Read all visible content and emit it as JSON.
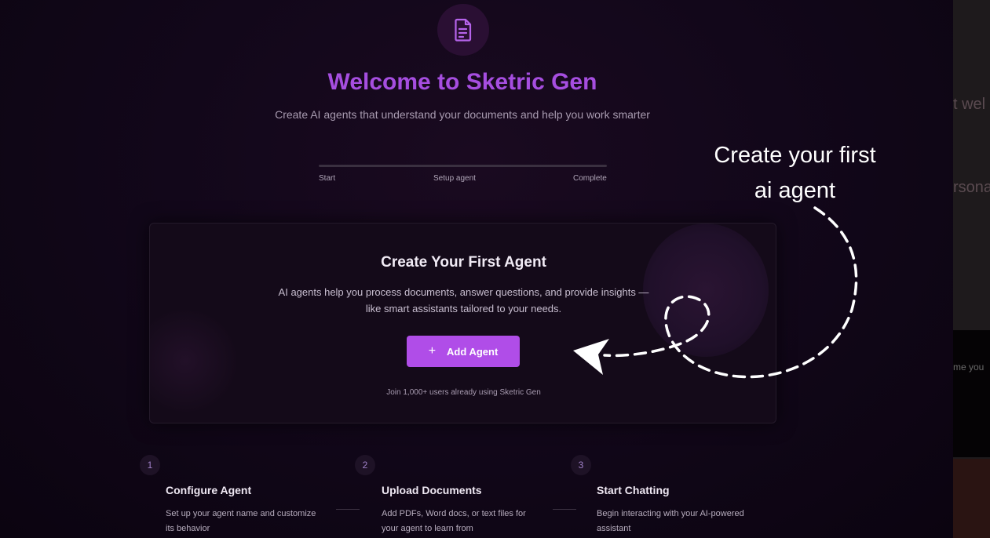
{
  "header": {
    "title": "Welcome to Sketric Gen",
    "subtitle": "Create AI agents that understand your documents and help you work smarter",
    "logo_icon": "document-icon"
  },
  "progress": {
    "steps": [
      "Start",
      "Setup agent",
      "Complete"
    ]
  },
  "card": {
    "title": "Create Your First Agent",
    "desc_line1": "AI agents help you process documents, answer questions, and provide insights —",
    "desc_line2": "like smart assistants tailored to your needs.",
    "button_label": "Add Agent",
    "button_icon": "plus-icon",
    "join_text": "Join 1,000+ users already using Sketric Gen"
  },
  "annotation": {
    "line1": "Create your first",
    "line2": "ai agent"
  },
  "steps": [
    {
      "number": "1",
      "title": "Configure Agent",
      "desc_line1": "Set up your agent name and customize",
      "desc_line2": "its behavior"
    },
    {
      "number": "2",
      "title": "Upload Documents",
      "desc_line1": "Add PDFs, Word docs, or text files for",
      "desc_line2": "your agent to learn from"
    },
    {
      "number": "3",
      "title": "Start Chatting",
      "desc_line1": "Begin interacting with your AI-powered",
      "desc_line2": "assistant"
    }
  ],
  "background_fragments": {
    "frag1": "t wel",
    "frag2": "rsona",
    "frag3": "me you"
  },
  "colors": {
    "accent": "#a64ee0",
    "button": "#b04de8",
    "background": "#12071a"
  }
}
